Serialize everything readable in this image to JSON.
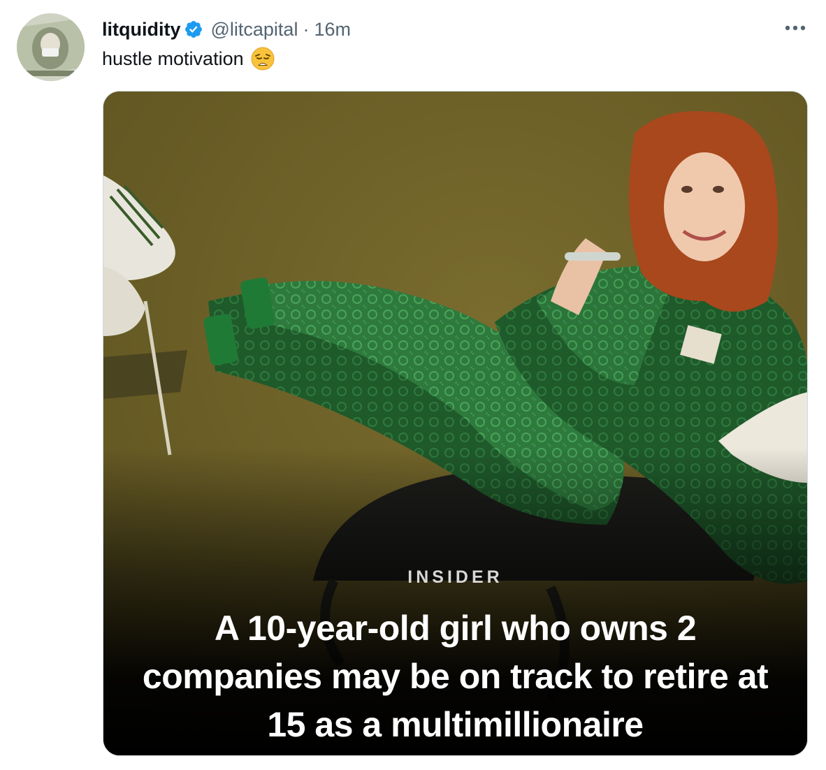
{
  "tweet": {
    "display_name": "litquidity",
    "handle": "@litcapital",
    "separator": "·",
    "time": "16m",
    "text": "hustle motivation",
    "emoji_name": "weary-face",
    "more_icon": "more-dots-icon",
    "verified_icon": "verified-badge-icon"
  },
  "media": {
    "brand": "INSIDER",
    "headline": "A 10-year-old girl who owns 2 companies may be on track to retire at 15 as a multimillionaire"
  },
  "colors": {
    "text_primary": "#0f1419",
    "text_secondary": "#536471",
    "verified_blue": "#1d9bf0",
    "border": "#cfd9de",
    "photo_background": "#6e6128",
    "outfit_green": "#2f7a3e"
  }
}
